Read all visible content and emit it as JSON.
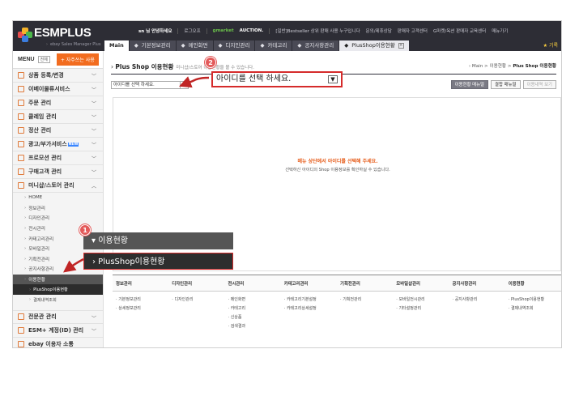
{
  "header": {
    "logo": "ESMPLUS",
    "logo_sub": "ebay Sales Manager Plus",
    "topbar": [
      "sn 님 안녕하세요",
      "로그오프",
      "gmarket",
      "AUCTION.",
      "[일반]Bestseller 상위 판매 사용 누구입니다",
      "문의/제휴상담",
      "판매자 고객센터",
      "G마켓/옥션 판매자 교육센터",
      "매뉴가기"
    ],
    "tabs": [
      "Main",
      "기본정보관리",
      "메인화면",
      "디지인관리",
      "카테고리",
      "공지사항관리",
      "PlusShop이용현황"
    ],
    "bookmark": "★ 기록"
  },
  "sidebar": {
    "menu_label": "MENU",
    "all_label": "전체",
    "favorite_label": "+ 자주쓰는 사용",
    "items": [
      {
        "label": "상품 등록/변경"
      },
      {
        "label": "이베이물류서비스"
      },
      {
        "label": "주문 관리"
      },
      {
        "label": "클레임 관리"
      },
      {
        "label": "정산 관리"
      },
      {
        "label": "광고/부가서비스",
        "badge": "NEW"
      },
      {
        "label": "프로모션 관리"
      },
      {
        "label": "구매고객 관리"
      },
      {
        "label": "미니샵/스토어 관리"
      }
    ],
    "subitems": [
      "HOME",
      "정보관리",
      "디자인관리",
      "전시관리",
      "카테고리관리",
      "모바일관리",
      "기획전관리",
      "공지사항관리",
      "이용현황"
    ],
    "subsub": [
      "PlusShop이용현황",
      "결제내역조회"
    ],
    "bottom_items": [
      "전문관 관리",
      "ESM+ 계정(ID) 관리",
      "ebay 이용자 소통"
    ]
  },
  "main": {
    "title": "Plus Shop 이용현황",
    "desc": "미니샵/스토어 이용현황을 볼 수 있습니다.",
    "breadcrumb": "Main > 이용현황 > ",
    "breadcrumb_current": "Plus Shop 이용현황",
    "select_small": "아이디를 선택 하세요.",
    "btn_usage": "이용현황 매뉴얼",
    "btn_order": "결합 매뉴얼",
    "btn_history": "이용내역 보기",
    "notice_1": "메뉴 상단에서 아이디를 선택해 주세요.",
    "notice_2": "선택하신 아이디의 Shop 이용정보를 확인하실 수 있습니다.",
    "grid": {
      "headers": [
        "정보관리",
        "디자인관리",
        "전시관리",
        "카테고리관리",
        "기획전관리",
        "모바일샵관리",
        "공지사항관리",
        "이용현황"
      ],
      "cols": [
        [
          "기본정보관리",
          "상세정보관리"
        ],
        [
          "디자인관리"
        ],
        [
          "메인화면",
          "카테고리",
          "신상품",
          "검색결과"
        ],
        [
          "카테고리기본설정",
          "카테고리상세설정"
        ],
        [
          "기획전관리"
        ],
        [
          "모바일전시관리",
          "기타설정관리"
        ],
        [
          "공지사항관리"
        ],
        [
          "PlusShop이용현황",
          "결제내역조회"
        ]
      ]
    }
  },
  "callouts": {
    "select_big": "아이디를 선택 하세요.",
    "menu_parent": "▾ 이용현황",
    "menu_child": "› PlusShop이용현황",
    "badge1": "1",
    "badge2": "2"
  },
  "colors": {
    "accent": "#f26c1f",
    "callout": "#d52b2b",
    "badge": "#e35a5a",
    "header_bg": "#2d2d35"
  }
}
